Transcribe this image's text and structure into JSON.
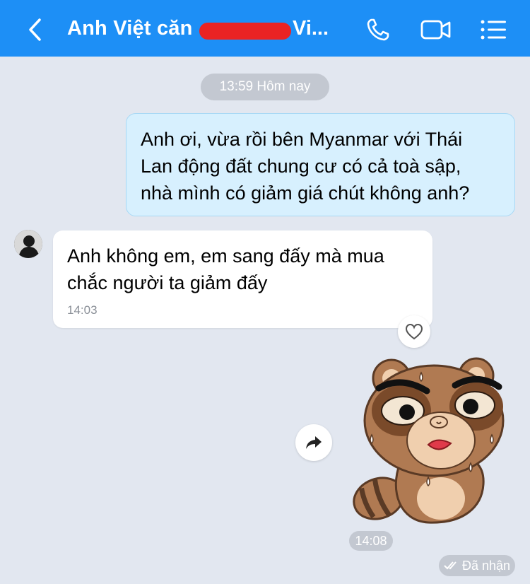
{
  "header": {
    "contact_name": "Anh Việt căn",
    "contact_name_suffix": "Vi...",
    "accent_color": "#1d8ff6",
    "icons": [
      "back-arrow-icon",
      "phone-icon",
      "video-call-icon",
      "menu-list-icon"
    ]
  },
  "chat": {
    "date_divider": "13:59 Hôm nay",
    "messages": [
      {
        "direction": "outgoing",
        "lines": [
          "Anh ơi, vừa rồi bên Myanmar với Thái",
          "Lan động đất chung cư có cả toà sập,",
          "nhà mình có giảm giá chút không anh?"
        ]
      },
      {
        "direction": "incoming",
        "lines": [
          "Anh không em, em sang đấy mà mua",
          "chắc người ta giảm đấy"
        ],
        "time": "14:03"
      },
      {
        "direction": "outgoing",
        "type": "sticker",
        "sticker": "sweating-raccoon-sticker",
        "time": "14:08"
      }
    ],
    "status": "Đã nhận"
  }
}
